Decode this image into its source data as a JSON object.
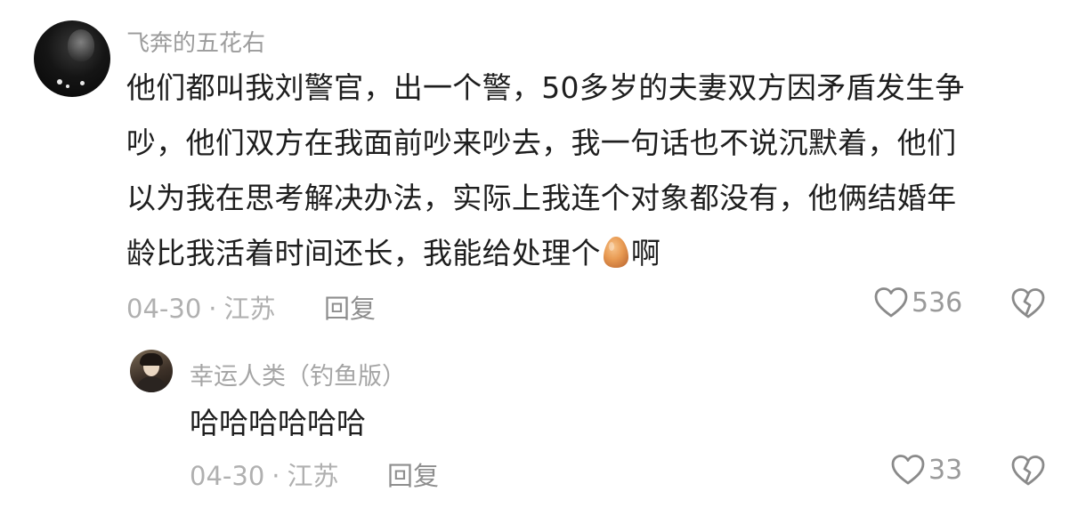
{
  "comment": {
    "username": "飞奔的五花右",
    "text_lines": [
      "他们都叫我刘警官，出一个警，50多岁的夫妻双方因矛盾发生争",
      "吵，他们双方在我面前吵来吵去，我一句话也不说沉默着，他们",
      "以为我在思考解决办法，实际上我连个对象都没有，他俩结婚年",
      "龄比我活着时间还长，我能给处理个"
    ],
    "text_tail": "啊",
    "inline_emoji": "egg-icon",
    "date": "04-30",
    "separator": "·",
    "location": "江苏",
    "reply_label": "回复",
    "like_count": "536",
    "like_icon": "heart-outline-icon",
    "dislike_icon": "broken-heart-icon"
  },
  "reply": {
    "username": "幸运人类（钓鱼版）",
    "text": "哈哈哈哈哈哈",
    "date": "04-30",
    "separator": "·",
    "location": "江苏",
    "reply_label": "回复",
    "like_count": "33",
    "like_icon": "heart-outline-icon",
    "dislike_icon": "broken-heart-icon"
  },
  "colors": {
    "text_primary": "#1e1e1e",
    "text_secondary": "#9c9c9c",
    "meta": "#b0b0b0",
    "icon": "#8a8a8a",
    "egg": "#e39a55"
  }
}
